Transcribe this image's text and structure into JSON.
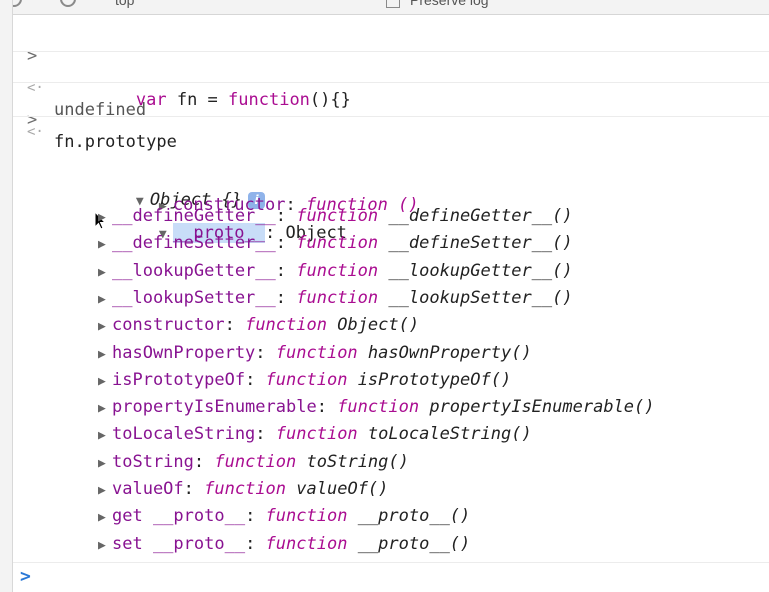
{
  "top_bar": {
    "context_label": "top",
    "file_label": "Preserve log"
  },
  "console": {
    "entries": [
      {
        "type": "input",
        "code": {
          "kw": "var",
          "rest": " fn = ",
          "kw2": "function",
          "rest2": "(){}"
        }
      },
      {
        "type": "result",
        "text": "undefined"
      },
      {
        "type": "input",
        "text": "fn.prototype"
      }
    ],
    "object": {
      "label": "Object {}",
      "info_icon": "i",
      "constructor": {
        "key": "constructor",
        "value": "function ()"
      },
      "proto": {
        "key": "__proto__",
        "value": "Object"
      },
      "proto_items": [
        {
          "key": "__defineGetter__",
          "fn": "function",
          "name": "__defineGetter__()"
        },
        {
          "key": "__defineSetter__",
          "fn": "function",
          "name": "__defineSetter__()"
        },
        {
          "key": "__lookupGetter__",
          "fn": "function",
          "name": "__lookupGetter__()"
        },
        {
          "key": "__lookupSetter__",
          "fn": "function",
          "name": "__lookupSetter__()"
        },
        {
          "key": "constructor",
          "fn": "function",
          "name": "Object()"
        },
        {
          "key": "hasOwnProperty",
          "fn": "function",
          "name": "hasOwnProperty()"
        },
        {
          "key": "isPrototypeOf",
          "fn": "function",
          "name": "isPrototypeOf()"
        },
        {
          "key": "propertyIsEnumerable",
          "fn": "function",
          "name": "propertyIsEnumerable()"
        },
        {
          "key": "toLocaleString",
          "fn": "function",
          "name": "toLocaleString()"
        },
        {
          "key": "toString",
          "fn": "function",
          "name": "toString()"
        },
        {
          "key": "valueOf",
          "fn": "function",
          "name": "valueOf()"
        },
        {
          "key": "get __proto__",
          "fn": "function",
          "name": "__proto__()"
        },
        {
          "key": "set __proto__",
          "fn": "function",
          "name": "__proto__()"
        }
      ]
    },
    "input_prompt": ">"
  },
  "colors": {
    "keyword": "#aa0d91",
    "property": "#881391",
    "prompt_active": "#2a78d6",
    "highlight": "#c8ddf8"
  }
}
